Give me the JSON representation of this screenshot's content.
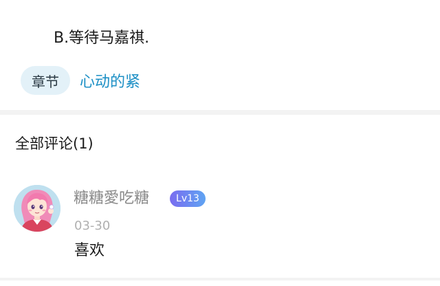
{
  "question": {
    "option_text": "B.等待马嘉祺."
  },
  "chapter": {
    "badge_label": "章节",
    "link_label": "心动的紧"
  },
  "comments": {
    "title": "全部评论(1)",
    "items": [
      {
        "username": "糖糖愛吃糖",
        "level": "Lv13",
        "date": "03-30",
        "text": "喜欢",
        "avatar": "avatar-anime-girl-pink-hair"
      }
    ]
  },
  "colors": {
    "accent_link": "#1b8fc5",
    "badge_bg": "#e3f1f8",
    "level_gradient_start": "#7a6cf0",
    "level_gradient_end": "#5fa4f2"
  }
}
